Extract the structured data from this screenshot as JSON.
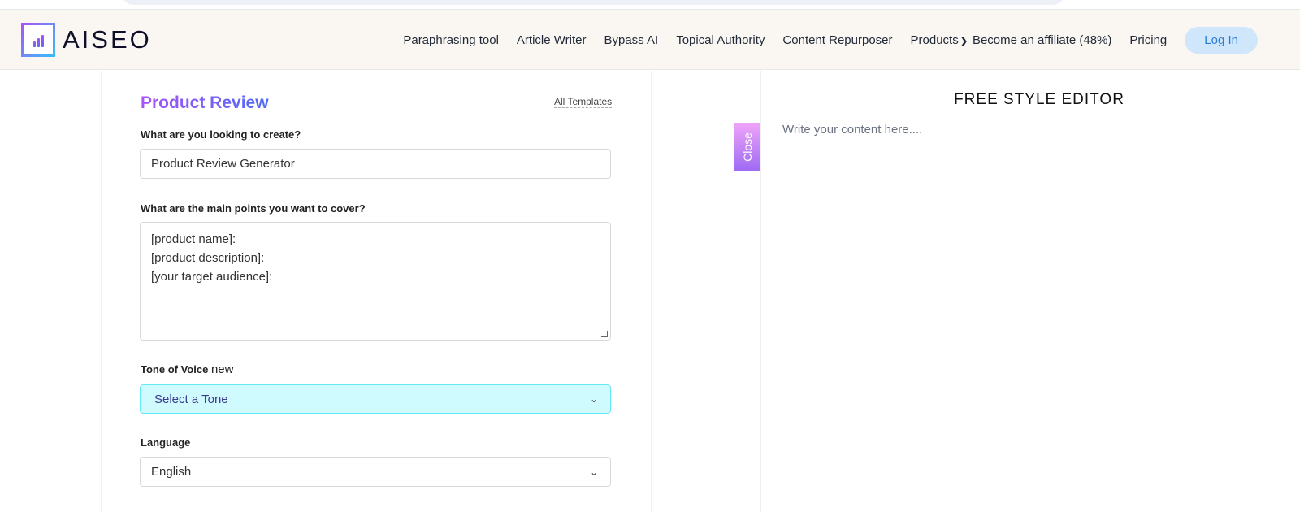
{
  "brand": {
    "name": "AISEO"
  },
  "nav": {
    "items": [
      "Paraphrasing tool",
      "Article Writer",
      "Bypass AI",
      "Topical Authority",
      "Content Repurposer",
      "Products",
      "Become an affiliate (48%)",
      "Pricing"
    ],
    "login": "Log In"
  },
  "form": {
    "title": "Product Review",
    "all_templates": "All Templates",
    "create_label": "What are you looking to create?",
    "create_value": "Product Review Generator",
    "points_label": "What are the main points you want to cover?",
    "points_lines": [
      "[product name]:",
      "[product description]:",
      "[your target audience]:"
    ],
    "tone_label": "Tone of Voice",
    "tone_badge": "new",
    "tone_value": "Select a Tone",
    "language_label": "Language",
    "language_value": "English"
  },
  "close_label": "Close",
  "editor": {
    "title": "FREE STYLE EDITOR",
    "placeholder": "Write your content here...."
  },
  "colors": {
    "accent_purple": "#a855f7",
    "accent_blue": "#4f6bf5",
    "tone_bg": "#cffafe",
    "login_bg": "#cfe6fb"
  }
}
